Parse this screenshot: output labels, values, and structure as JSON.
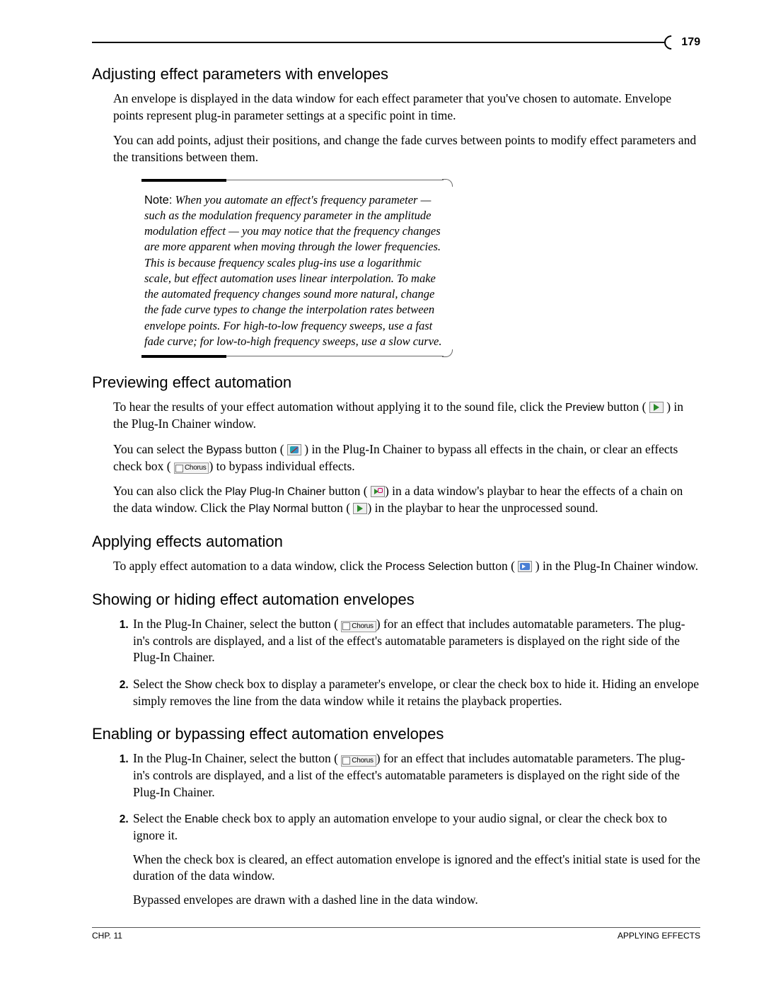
{
  "page_number": "179",
  "chapter_ref": "CHP. 11",
  "footer_title": "APPLYING EFFECTS",
  "sections": {
    "adjusting": {
      "heading": "Adjusting effect parameters with envelopes",
      "p1": "An envelope is displayed in the data window for each effect parameter that you've chosen to automate. Envelope points represent plug-in parameter settings at a specific point in time.",
      "p2": "You can add points, adjust their positions, and change the fade curves between points to modify effect parameters and the transitions between them.",
      "note_label": "Note:",
      "note_text": "When you automate an effect's frequency parameter — such as the modulation frequency parameter in the amplitude modulation effect — you may notice that the frequency changes are more apparent when moving through the lower frequencies. This is because frequency scales plug-ins use a logarithmic scale, but effect automation uses linear interpolation. To make the automated frequency changes sound more natural, change the fade curve types to change the interpolation rates between envelope points. For high-to-low frequency sweeps, use a fast fade curve; for low-to-high frequency sweeps, use a slow curve."
    },
    "previewing": {
      "heading": "Previewing effect automation",
      "p1a": "To hear the results of your effect automation without applying it to the sound file, click the ",
      "preview_label": "Preview",
      "p1b": " button ( ",
      "p1c": " ) in the Plug-In Chainer window.",
      "p2a": "You can select the ",
      "bypass_label": "Bypass",
      "p2b": " button ( ",
      "p2c": " ) in the Plug-In Chainer to bypass all effects in the chain, or clear an effects check box ( ",
      "chip_label": "Chorus",
      "p2d": ") to bypass individual effects.",
      "p3a": "You can also click the ",
      "play_chain_label": "Play Plug-In Chainer",
      "p3b": " button ( ",
      "p3c": ") in a data window's playbar to hear the effects of a chain on the data window. Click the ",
      "play_normal_label": "Play Normal",
      "p3d": " button ( ",
      "p3e": ") in the playbar to hear the unprocessed sound."
    },
    "applying": {
      "heading": "Applying effects automation",
      "p1a": "To apply effect automation to a data window, click the ",
      "process_label": "Process Selection",
      "p1b": " button ( ",
      "p1c": " ) in the Plug-In Chainer window."
    },
    "showing": {
      "heading": "Showing or hiding effect automation envelopes",
      "step1a": "In the Plug-In Chainer, select the button ( ",
      "step1b": ") for an effect that includes automatable parameters. The plug-in's controls are displayed, and a list of the effect's automatable parameters is displayed on the right side of the Plug-In Chainer.",
      "step2a": "Select the ",
      "show_label": "Show",
      "step2b": " check box to display a parameter's envelope, or clear the check box to hide it. Hiding an envelope simply removes the line from the data window while it retains the playback properties."
    },
    "enabling": {
      "heading": "Enabling or bypassing effect automation envelopes",
      "step1a": "In the Plug-In Chainer, select the button ( ",
      "step1b": ") for an effect that includes automatable parameters. The plug-in's controls are displayed, and a list of the effect's automatable parameters is displayed on the right side of the Plug-In Chainer.",
      "step2a": "Select the ",
      "enable_label": "Enable",
      "step2b": " check box to apply an automation envelope to your audio signal, or clear the check box to ignore it.",
      "step2p2": "When the check box is cleared, an effect automation envelope is ignored and the effect's initial state is used for the duration of the data window.",
      "step2p3": "Bypassed envelopes are drawn with a dashed line in the data window."
    }
  }
}
